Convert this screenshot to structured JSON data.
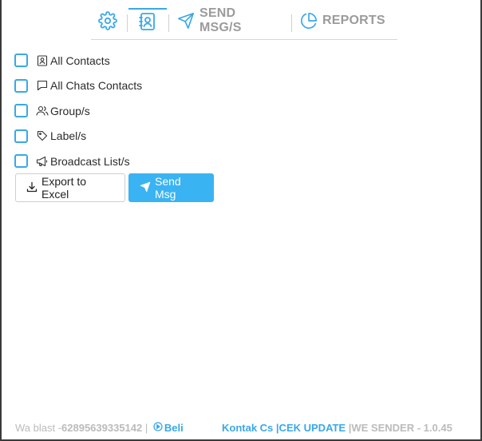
{
  "tabs": {
    "settings": {
      "icon": "gear-icon"
    },
    "contacts": {
      "icon": "contact-book-icon",
      "active": true
    },
    "send": {
      "icon": "paper-plane-icon",
      "label": "SEND MSG/S"
    },
    "reports": {
      "icon": "pie-chart-icon",
      "label": "REPORTS"
    }
  },
  "options": [
    {
      "icon": "contact-card-icon",
      "label": "All Contacts",
      "checked": false
    },
    {
      "icon": "chat-bubble-icon",
      "label": "All Chats Contacts",
      "checked": false
    },
    {
      "icon": "users-icon",
      "label": "Group/s",
      "checked": false
    },
    {
      "icon": "tag-icon",
      "label": "Label/s",
      "checked": false
    },
    {
      "icon": "megaphone-icon",
      "label": "Broadcast List/s",
      "checked": false
    }
  ],
  "actions": {
    "export_label": "Export to Excel",
    "send_label": "Send Msg"
  },
  "footer": {
    "app": "Wa blast - ",
    "phone": "62895639335142",
    "pipe": " | ",
    "beli": "Beli",
    "kontak": "Kontak Cs",
    "cek_update": "|CEK UPDATE",
    "sender": "|WE SENDER - 1.0.45"
  },
  "colors": {
    "accent": "#39a8e8",
    "send_button": "#3ab3f2",
    "muted": "#9b9b9b"
  }
}
